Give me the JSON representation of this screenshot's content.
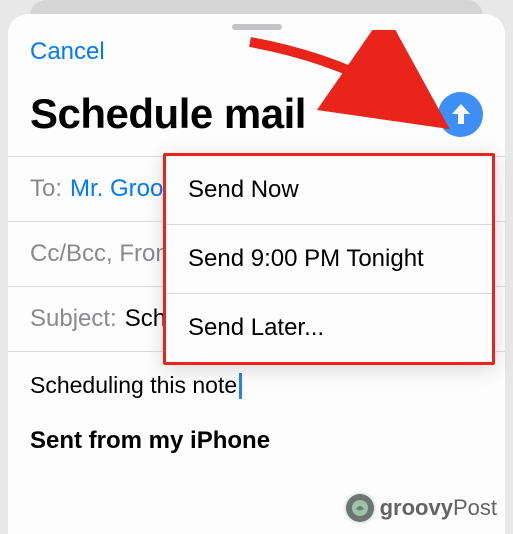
{
  "header": {
    "cancel": "Cancel",
    "title": "Schedule mail"
  },
  "fields": {
    "to_label": "To:",
    "to_value": "Mr. Groov",
    "ccbcc_label": "Cc/Bcc, From",
    "subject_label": "Subject:",
    "subject_value": "Schedule mail"
  },
  "body": {
    "line1": "Scheduling this note",
    "signature": "Sent from my iPhone"
  },
  "popover": {
    "items": [
      "Send Now",
      "Send 9:00 PM Tonight",
      "Send Later..."
    ]
  },
  "watermark": {
    "brand_bold": "groovy",
    "brand_rest": "Post"
  }
}
